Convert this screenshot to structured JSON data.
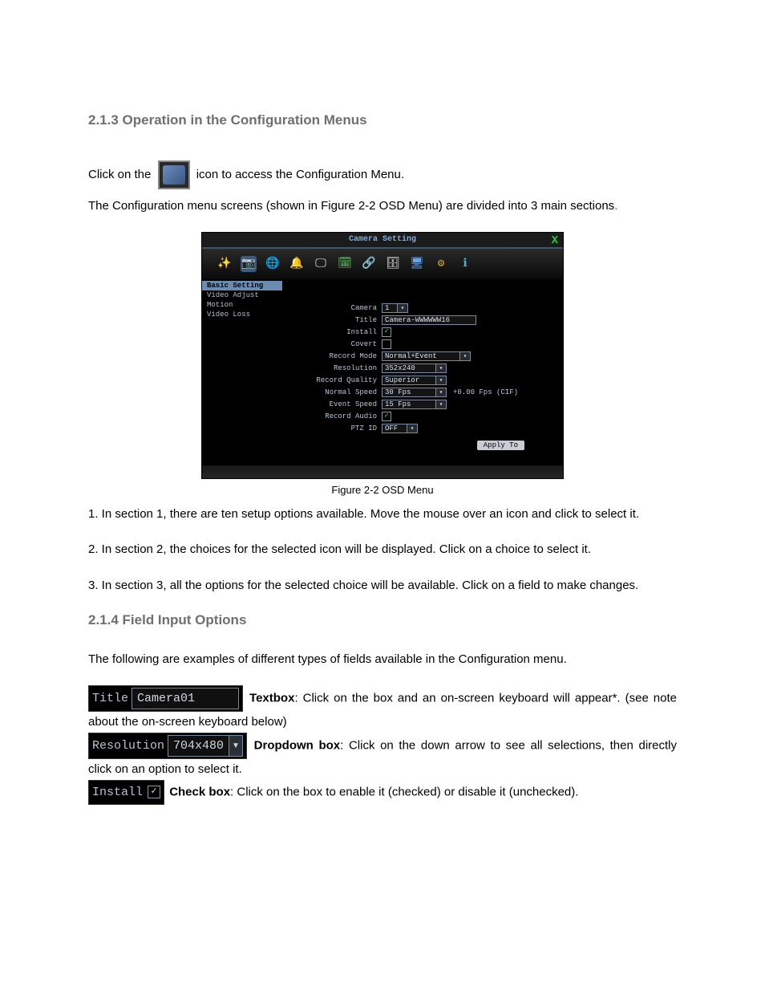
{
  "headings": {
    "h213": "2.1.3   Operation in the Configuration Menus",
    "h214": "2.1.4   Field Input Options"
  },
  "intro": {
    "click_pre": "Click on the ",
    "click_post": " icon to access the Configuration Menu.",
    "line2_a": "The Configuration menu screens (shown in Figure 2-2 OSD Menu) are divided into 3 main sections",
    "line2_dot": "."
  },
  "figure": {
    "caption": "Figure 2-2 OSD Menu"
  },
  "osd": {
    "title": "Camera Setting",
    "close": "X",
    "toolbar_icons": [
      "wand-icon",
      "camera-icon",
      "globe-icon",
      "bell-icon",
      "display-icon",
      "schedule-icon",
      "network-icon",
      "storage-icon",
      "monitor-icon",
      "gear-icon",
      "info-icon"
    ],
    "toolbar_glyphs": [
      "✨",
      "📷",
      "🌐",
      "🔔",
      "🖵",
      "🗓",
      "🔗",
      "🗄",
      "🖥",
      "⚙",
      "ℹ"
    ],
    "side": {
      "items": [
        "Basic Setting",
        "Video Adjust",
        "Motion",
        "Video Loss"
      ],
      "selected": 0
    },
    "fields": {
      "camera_label": "Camera",
      "camera_val": "1",
      "title_label": "Title",
      "title_val": "Camera-WWWWWW16",
      "install_label": "Install",
      "covert_label": "Covert",
      "recmode_label": "Record Mode",
      "recmode_val": "Normal+Event",
      "resolution_label": "Resolution",
      "resolution_val": "352x240",
      "recq_label": "Record Quality",
      "recq_val": "Superior",
      "nspeed_label": "Normal Speed",
      "nspeed_val": "30 Fps",
      "nspeed_extra": "+0.00 Fps (CIF)",
      "espeed_label": "Event Speed",
      "espeed_val": "15 Fps",
      "recaudio_label": "Record Audio",
      "ptz_label": "PTZ ID",
      "ptz_val": "OFF",
      "apply": "Apply To"
    }
  },
  "list": {
    "n1": "1. In section 1, there are ten setup options available. Move the mouse over an icon and click to select it.",
    "n2": "2. In section 2, the choices for the selected icon will be displayed. Click on a choice to select it.",
    "n3": "3. In section 3, all the options for the selected choice will be available. Click on a field to make changes."
  },
  "field_intro": "The following are examples of different types of fields available in the Configuration menu.",
  "examples": {
    "tb_label": "Title",
    "tb_val": "Camera01",
    "tb_term": "Textbox",
    "tb_desc": ": Click on the box and an on-screen keyboard will appear*. (see note about the on-screen keyboard below)",
    "dd_label": "Resolution",
    "dd_val": "704x480",
    "dd_term": "Dropdown box",
    "dd_desc": ": Click on the down arrow to see all selections, then directly click on an option to select it.",
    "cb_label": "Install",
    "cb_term": "Check box",
    "cb_desc": ": Click on the box to enable it (checked) or disable it (unchecked)."
  }
}
